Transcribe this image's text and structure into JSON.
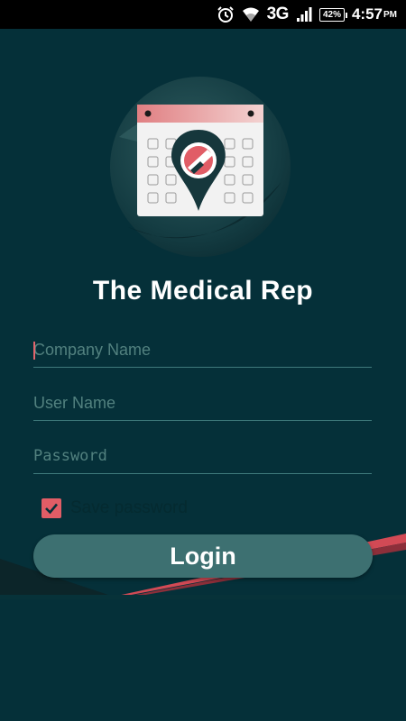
{
  "status_bar": {
    "network": "3G",
    "battery": "42%",
    "time": "4:57",
    "ampm": "PM",
    "icons": [
      "alarm-icon",
      "wifi-icon",
      "signal-icon",
      "battery-icon"
    ]
  },
  "app": {
    "title": "The Medical Rep"
  },
  "form": {
    "company_placeholder": "Company Name",
    "company_value": "",
    "username_placeholder": "User Name",
    "username_value": "",
    "password_placeholder": "Password",
    "password_value": "",
    "save_password_label": "Save password",
    "save_password_checked": true,
    "login_label": "Login"
  },
  "colors": {
    "background": "#053039",
    "accent": "#e15d66",
    "button": "#3d7071",
    "placeholder": "#52817f"
  }
}
